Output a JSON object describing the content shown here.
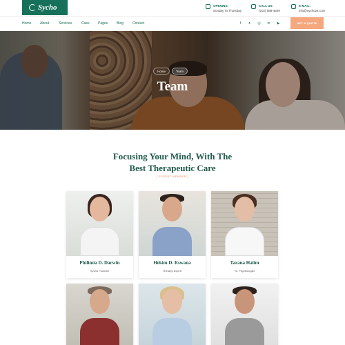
{
  "brand": {
    "name": "Sycho"
  },
  "topbar": {
    "opening_label": "OPENING:",
    "opening_value": "Sunday To Thursday",
    "call_label": "CALL US:",
    "call_value": "(202) 588-4509",
    "email_label": "E-MAIL:",
    "email_value": "info@sycho24.com"
  },
  "nav": {
    "items": [
      "Home",
      "About",
      "Services",
      "Case",
      "Pages",
      "Blog",
      "Contact"
    ],
    "social": [
      "f",
      "✦",
      "◎",
      "in",
      "▶"
    ],
    "cta": "GET A QUOTE"
  },
  "hero": {
    "breadcrumb": [
      "Home",
      "Team"
    ],
    "title": "Team"
  },
  "section": {
    "title_line1": "Focusing Your Mind, With The",
    "title_line2": "Best Therapeutic Care",
    "tag": "[ EXPERT MEMBER ]"
  },
  "team": [
    {
      "name": "Philimia D. Darwin",
      "role": "Sycho Founder"
    },
    {
      "name": "Hekim D. Rswana",
      "role": "Therapy Expert"
    },
    {
      "name": "Tarana Halim",
      "role": "Sr. Psychologist"
    },
    {
      "name": "",
      "role": ""
    },
    {
      "name": "",
      "role": ""
    },
    {
      "name": "",
      "role": ""
    }
  ],
  "colors": {
    "brand": "#17705a",
    "accent": "#f5a77e",
    "title": "#1f5a4a"
  }
}
